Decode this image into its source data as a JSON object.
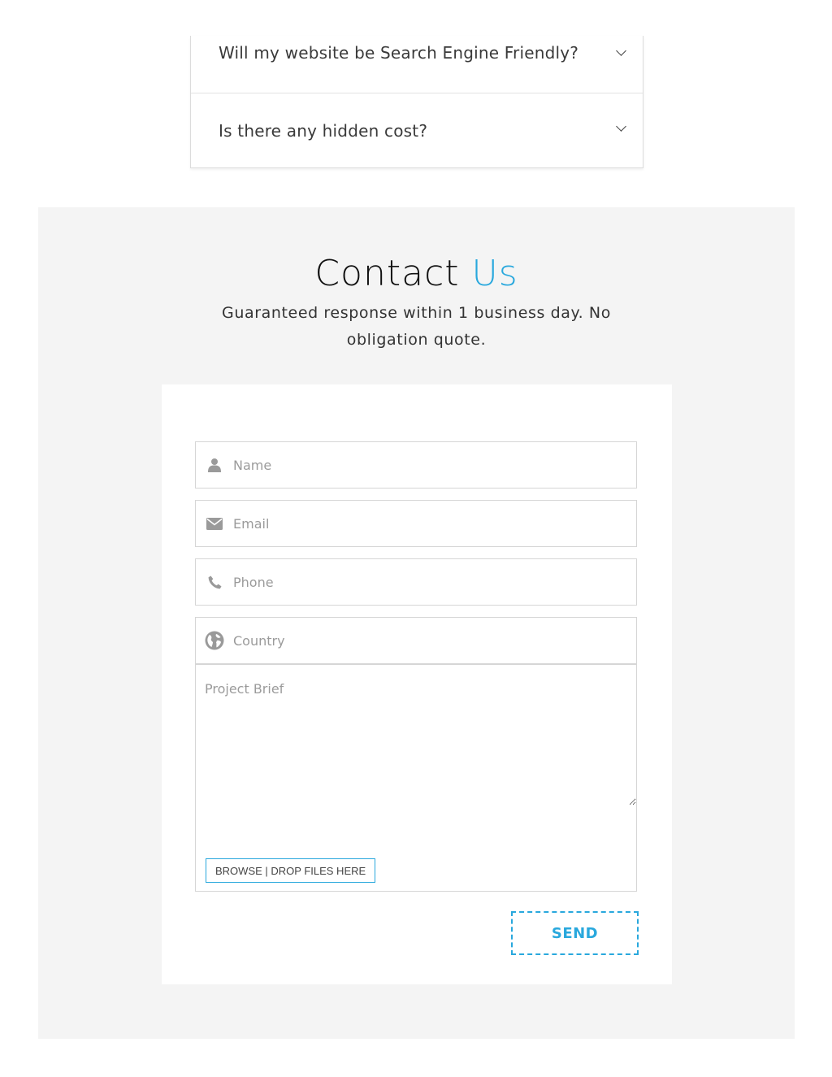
{
  "faq": {
    "items": [
      {
        "question": "Will my website be Search Engine Friendly?"
      },
      {
        "question": "Is there any hidden cost?"
      }
    ]
  },
  "contact": {
    "title_main": "Contact",
    "title_accent": "Us",
    "subtitle": "Guaranteed response within 1 business day. No obligation quote.",
    "form": {
      "name_placeholder": "Name",
      "email_placeholder": "Email",
      "phone_placeholder": "Phone",
      "country_placeholder": "Country",
      "brief_placeholder": "Project Brief",
      "browse_label": "BROWSE | DROP FILES HERE",
      "send_label": "SEND"
    }
  },
  "colors": {
    "accent": "#29a8dd",
    "section_bg": "#f4f4f4"
  },
  "icons": {
    "name": "user-icon",
    "email": "envelope-icon",
    "phone": "phone-icon",
    "country": "globe-icon",
    "faq_toggle": "chevron-down-icon"
  }
}
